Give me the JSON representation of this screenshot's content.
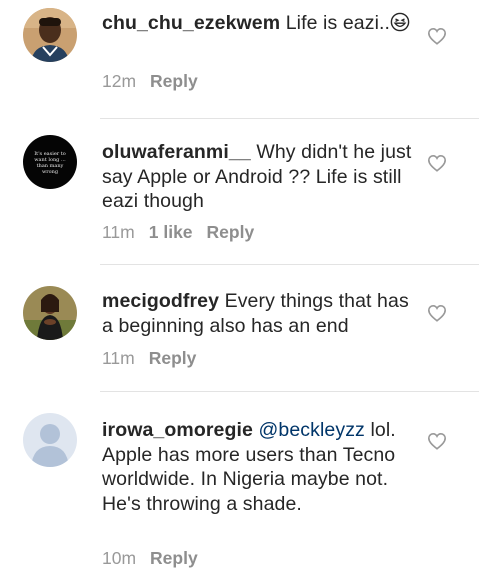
{
  "comments": [
    {
      "username": "chu_chu_ezekwem",
      "text": "Life is eazi..",
      "emoji": "grinning-squinting-face",
      "time": "12m",
      "likes": "",
      "reply_label": "Reply"
    },
    {
      "username": "oluwaferanmi__",
      "text": "Why didn't he just say Apple or Android ?? Life is still eazi though",
      "avatar_text": "It's easier to want long ... than many wrong",
      "time": "11m",
      "likes": "1 like",
      "reply_label": "Reply"
    },
    {
      "username": "mecigodfrey",
      "text": "Every things that has a beginning also has an end",
      "time": "11m",
      "likes": "",
      "reply_label": "Reply"
    },
    {
      "username": "irowa_omoregie",
      "mention": "@beckleyzz",
      "text": "lol. Apple has more users than Tecno worldwide. In Nigeria maybe not. He's throwing a shade.",
      "time": "10m",
      "likes": "",
      "reply_label": "Reply"
    }
  ],
  "colors": {
    "text": "#262626",
    "meta": "#999999",
    "mention": "#003569",
    "divider": "#e3e3e3"
  }
}
